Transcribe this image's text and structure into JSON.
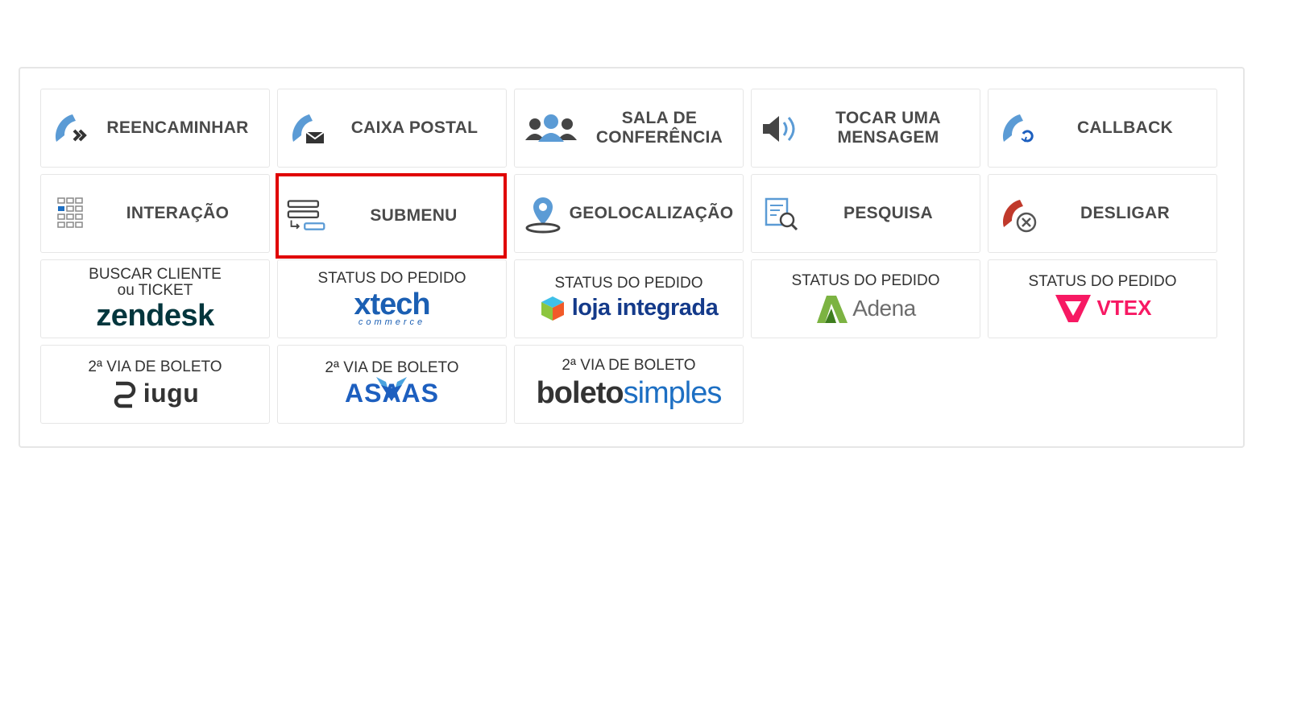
{
  "colors": {
    "icon_blue": "#5b9bd5",
    "icon_gray": "#555555",
    "highlight": "#e00000",
    "hangup_red": "#c0392b"
  },
  "row1": [
    {
      "label": "REENCAMINHAR",
      "icon": "phone-forward-icon"
    },
    {
      "label": "CAIXA POSTAL",
      "icon": "phone-mail-icon"
    },
    {
      "label_line1": "SALA DE",
      "label_line2": "CONFERÊNCIA",
      "icon": "people-group-icon"
    },
    {
      "label_line1": "TOCAR UMA",
      "label_line2": "MENSAGEM",
      "icon": "speaker-icon"
    },
    {
      "label": "CALLBACK",
      "icon": "phone-callback-icon"
    }
  ],
  "row2": [
    {
      "label": "INTERAÇÃO",
      "icon": "keypad-icon"
    },
    {
      "label": "SUBMENU",
      "icon": "submenu-icon"
    },
    {
      "label": "GEOLOCALIZAÇÃO",
      "icon": "map-pin-icon"
    },
    {
      "label": "PESQUISA",
      "icon": "document-search-icon"
    },
    {
      "label": "DESLIGAR",
      "icon": "phone-hangup-icon"
    }
  ],
  "row3": [
    {
      "caption_line1": "BUSCAR CLIENTE",
      "caption_line2": "ou TICKET",
      "brand": "zendesk"
    },
    {
      "caption": "STATUS DO PEDIDO",
      "brand": "xtech",
      "brand_sub": "commerce"
    },
    {
      "caption": "STATUS DO PEDIDO",
      "brand": "loja integrada"
    },
    {
      "caption": "STATUS DO PEDIDO",
      "brand": "Adena"
    },
    {
      "caption": "STATUS DO PEDIDO",
      "brand": "VTEX"
    }
  ],
  "row4": [
    {
      "caption": "2ª VIA DE BOLETO",
      "brand": "iugu"
    },
    {
      "caption": "2ª VIA DE BOLETO",
      "brand": "ASAAS"
    },
    {
      "caption": "2ª VIA DE BOLETO",
      "brand_part1": "boleto",
      "brand_part2": "simples"
    }
  ]
}
